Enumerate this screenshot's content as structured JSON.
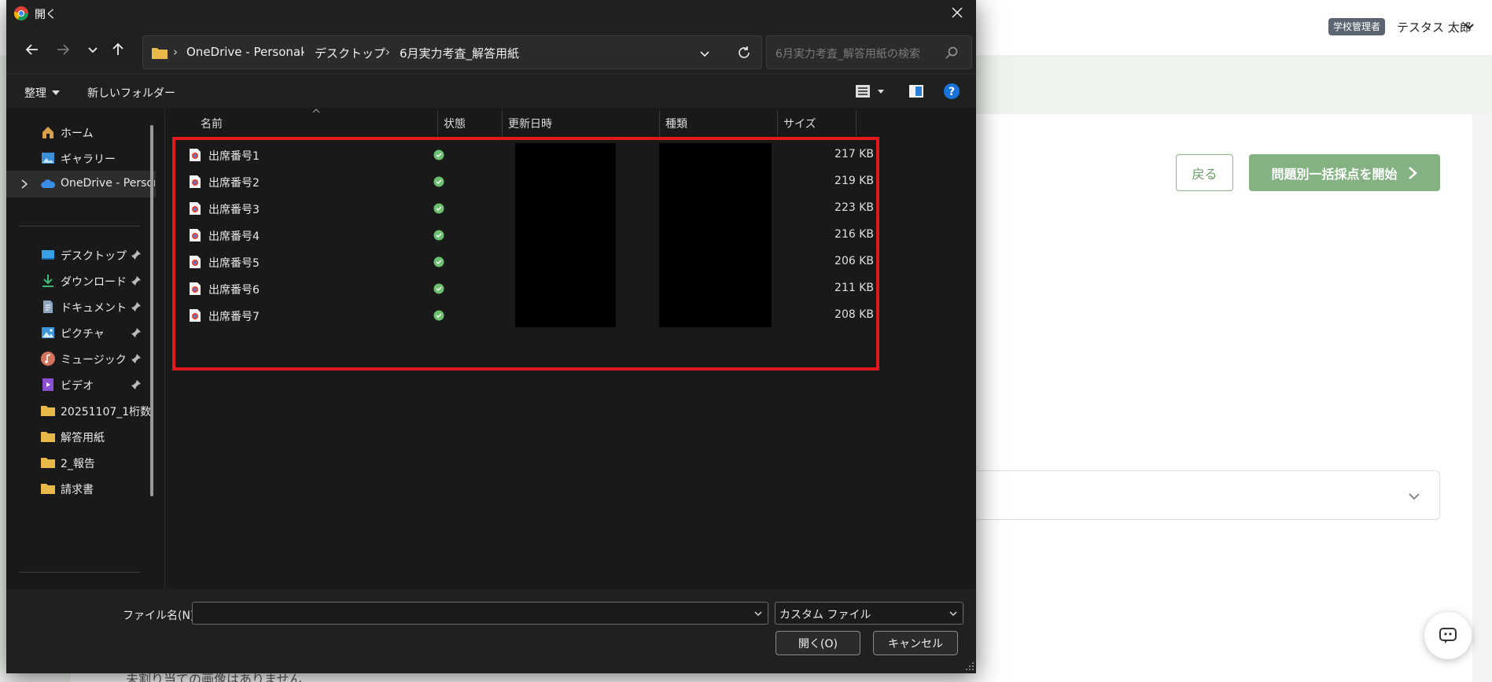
{
  "app": {
    "role_badge": "学校管理者",
    "user_name": "テスタス 太郎",
    "back_label": "戻る",
    "start_label": "問題別一括採点を開始",
    "bottom_notice": "未割り当ての画像はありません"
  },
  "dialog": {
    "title": "開く",
    "breadcrumb": [
      "OneDrive - Personal",
      "デスクトップ",
      "6月実力考査_解答用紙"
    ],
    "search_placeholder": "6月実力考査_解答用紙の検索",
    "commands": {
      "organize": "整理",
      "new_folder": "新しいフォルダー"
    },
    "sidebar": [
      {
        "label": "ホーム",
        "icon": "home-icon",
        "pinned": false
      },
      {
        "label": "ギャラリー",
        "icon": "gallery-icon",
        "pinned": false
      },
      {
        "label": "OneDrive - Personal",
        "icon": "onedrive-cloud-icon",
        "pinned": false,
        "selected": true
      },
      {
        "label": "デスクトップ",
        "icon": "desktop-icon",
        "pinned": true
      },
      {
        "label": "ダウンロード",
        "icon": "download-icon",
        "pinned": true
      },
      {
        "label": "ドキュメント",
        "icon": "document-icon",
        "pinned": true
      },
      {
        "label": "ピクチャ",
        "icon": "pictures-icon",
        "pinned": true
      },
      {
        "label": "ミュージック",
        "icon": "music-icon",
        "pinned": true
      },
      {
        "label": "ビデオ",
        "icon": "video-icon",
        "pinned": true
      },
      {
        "label": "20251107_1桁数",
        "icon": "folder-icon",
        "pinned": false
      },
      {
        "label": "解答用紙",
        "icon": "folder-icon",
        "pinned": false
      },
      {
        "label": "2_報告",
        "icon": "folder-icon",
        "pinned": false
      },
      {
        "label": "請求書",
        "icon": "folder-icon",
        "pinned": false
      }
    ],
    "columns": {
      "name": "名前",
      "status": "状態",
      "modified": "更新日時",
      "type": "種類",
      "size": "サイズ"
    },
    "files": [
      {
        "name": "出席番号1",
        "size": "217 KB"
      },
      {
        "name": "出席番号2",
        "size": "219 KB"
      },
      {
        "name": "出席番号3",
        "size": "223 KB"
      },
      {
        "name": "出席番号4",
        "size": "216 KB"
      },
      {
        "name": "出席番号5",
        "size": "206 KB"
      },
      {
        "name": "出席番号6",
        "size": "211 KB"
      },
      {
        "name": "出席番号7",
        "size": "208 KB"
      }
    ],
    "filename_label": "ファイル名(N):",
    "filename_value": "",
    "filetype": "カスタム ファイル",
    "open_label": "開く(O)",
    "cancel_label": "キャンセル"
  },
  "colors": {
    "dialog_bg": "#191919",
    "highlight": "#e0191d",
    "accent_green": "#85b283",
    "status_ok": "#6cc070"
  }
}
